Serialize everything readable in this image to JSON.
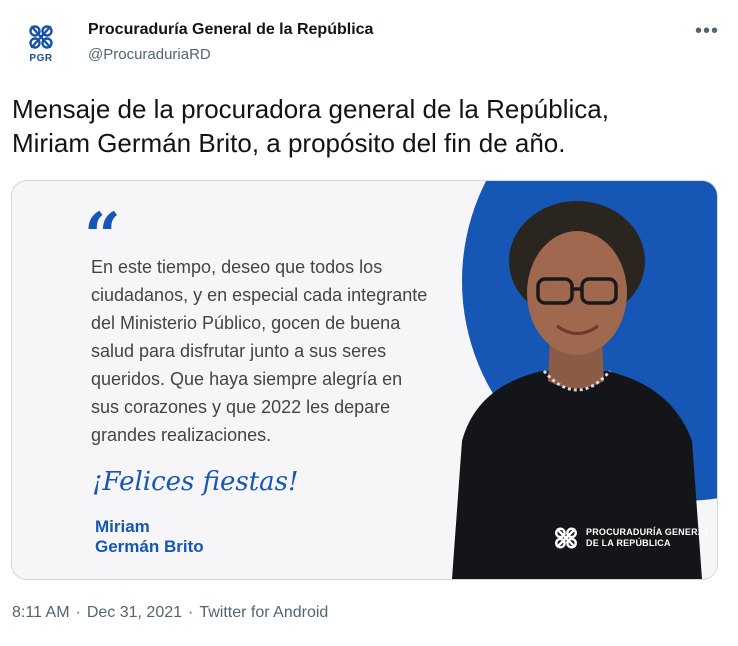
{
  "account": {
    "display_name": "Procuraduría General de la República",
    "handle": "@ProcuraduriaRD",
    "avatar_text": "PGR"
  },
  "tweet": {
    "text": "Mensaje de la procuradora general de la República,\nMiriam Germán Brito, a propósito del fin de año."
  },
  "media": {
    "quote_mark": "“",
    "message": "En este tiempo, deseo que todos los\nciudadanos, y en especial cada integrante\ndel Ministerio Público, gocen de buena\nsalud para disfrutar junto a sus seres\nqueridos. Que haya siempre alegría en\nsus corazones y que 2022 les depare\ngrandes realizaciones.",
    "greeting": "¡Felices fiestas!",
    "signature": "Miriam\nGermán Brito",
    "org_logo_text": "PROCURADURÍA GENERAL\nDE LA REPÚBLICA"
  },
  "meta": {
    "time": "8:11 AM",
    "separator1": "·",
    "date": "Dec 31, 2021",
    "separator2": "·",
    "source": "Twitter for Android"
  },
  "colors": {
    "brand_blue": "#1656b4",
    "text_primary": "#0f1419",
    "text_secondary": "#536471"
  },
  "icons": {
    "more": "more-horizontal-icon",
    "avatar": "pgr-logo-icon"
  }
}
